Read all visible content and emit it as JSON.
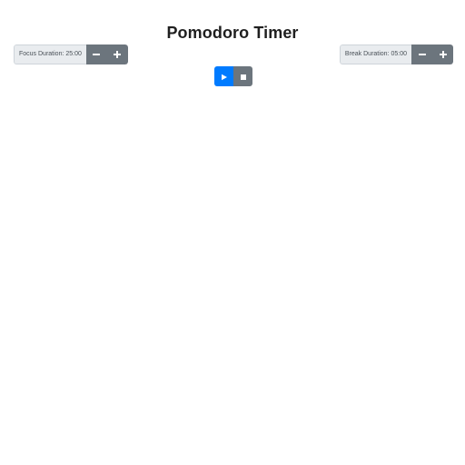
{
  "app": {
    "title": "Pomodoro Timer"
  },
  "focus": {
    "label": "Focus Duration: 25:00",
    "decrease_icon": "minus-icon",
    "increase_icon": "plus-icon"
  },
  "break": {
    "label": "Break Duration: 05:00",
    "decrease_icon": "minus-icon",
    "increase_icon": "plus-icon"
  },
  "controls": {
    "play_icon": "play-icon",
    "stop_icon": "stop-icon"
  },
  "colors": {
    "primary": "#007bff",
    "secondary": "#6c757d",
    "label_bg": "#e9ecef",
    "title_text": "#1f1f1f"
  }
}
